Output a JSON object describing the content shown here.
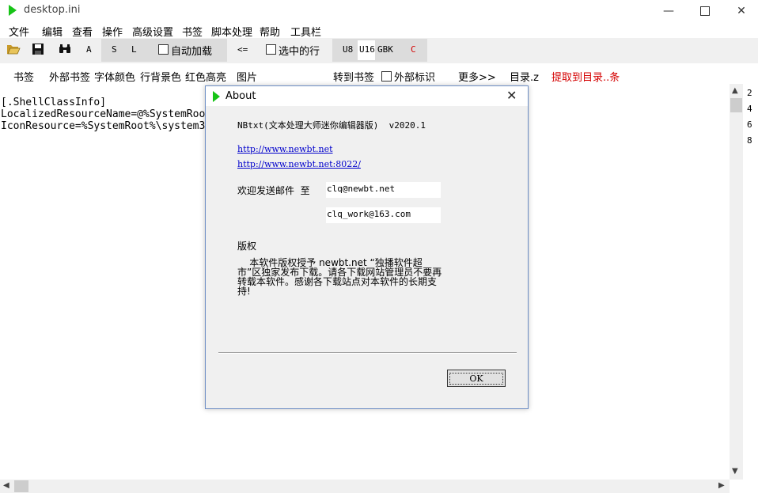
{
  "window": {
    "title": "desktop.ini",
    "min_glyph": "—",
    "close_glyph": "✕"
  },
  "menu": [
    "文件",
    "编辑",
    "查看",
    "操作",
    "高级设置",
    "书签",
    "脚本处理",
    "帮助",
    "工具栏"
  ],
  "toolbar": {
    "a_label": "A",
    "s_label": "S",
    "l_label": "L",
    "auto_load_label": "自动加载",
    "back_label": "<=",
    "selected_line_label": "选中的行",
    "u8_label": "U8",
    "u16_label": "U16",
    "gbk_label": "GBK",
    "c_label": "C"
  },
  "toolbar2": {
    "bookmark": "书签",
    "ext_bookmark": "外部书签",
    "font_color": "字体颜色",
    "line_bg": "行背景色",
    "red_highlight": "红色高亮",
    "image": "图片",
    "goto_bookmark": "转到书签",
    "ext_mark": "外部标识",
    "more": "更多>>",
    "toc": "目录.z",
    "extract_toc": "提取到目录..条"
  },
  "editor": {
    "lines": [
      "[.ShellClassInfo]",
      "LocalizedResourceName=@%SystemRoot%\\system32\\shell32.dll,-21770",
      "IconResource=%SystemRoot%\\system32\\imageres.dll,-183"
    ]
  },
  "line_numbers": [
    "2",
    "4",
    "6",
    "8"
  ],
  "dialog": {
    "title": "About",
    "app_name": "NBtxt(文本处理大师迷你编辑器版)  v2020.1",
    "link1": "http://www.newbt.net",
    "link2": "http://www.newbt.net:8022/",
    "email_label": "欢迎发送邮件  至",
    "email1": "clq@newbt.net",
    "email2": "clq_work@163.com",
    "copyright_heading": "版权",
    "copyright_text": "    本软件版权授予 newbt.net “独播软件超市”区独家发布下载。请各下载网站管理员不要再转载本软件。感谢各下载站点对本软件的长期支持!",
    "ok_label": "OK"
  },
  "colors": {
    "accent_green": "#17c417",
    "red_text": "#d40000",
    "link_blue": "#0000cc"
  }
}
